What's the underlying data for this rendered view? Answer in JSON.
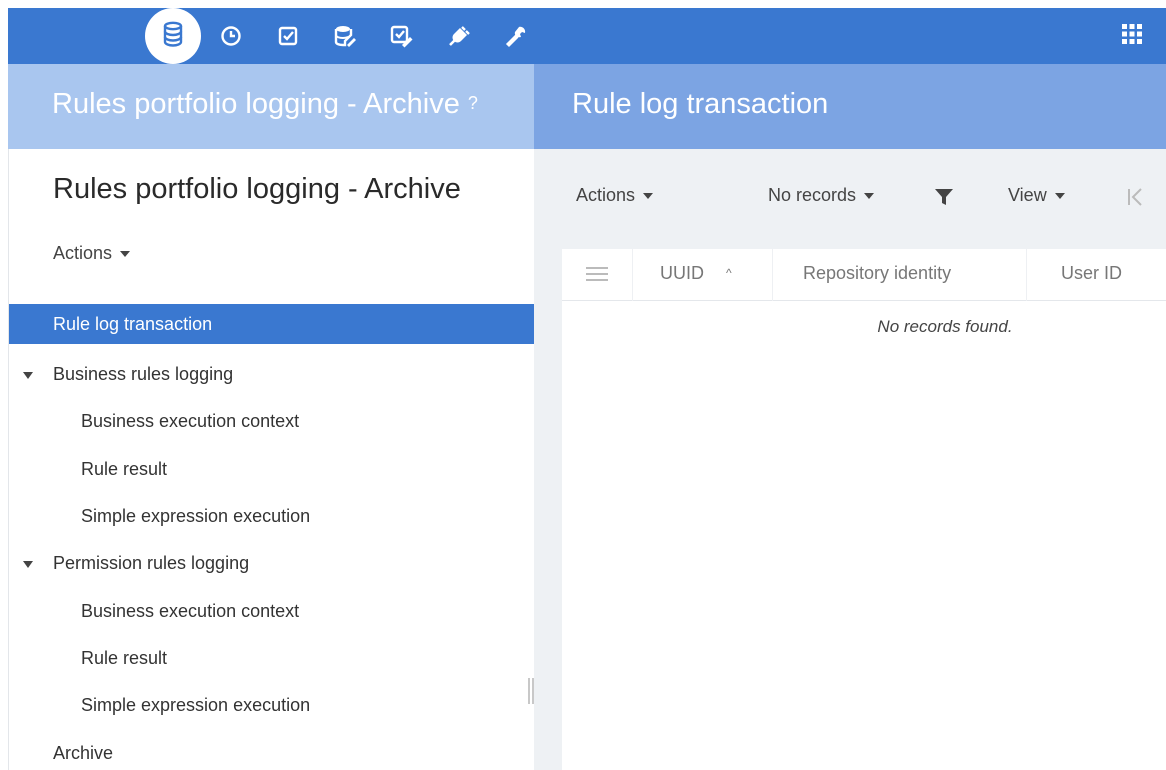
{
  "toolbar": {
    "icons": [
      "database-icon",
      "clock-icon",
      "checkbox-icon",
      "database-edit-icon",
      "checklist-edit-icon",
      "plug-icon",
      "wrench-icon"
    ],
    "active_icon": "database-icon",
    "apps_icon": "apps-grid-icon",
    "accent_color": "#3a78d0"
  },
  "header": {
    "left_title": "Rules portfolio logging - Archive",
    "help_mark": "?",
    "right_title": "Rule log transaction"
  },
  "left": {
    "page_title": "Rules portfolio logging - Archive",
    "actions_label": "Actions",
    "tree": [
      {
        "label": "Rule log transaction",
        "level": 0,
        "selected": true
      },
      {
        "label": "Business rules logging",
        "level": 0,
        "expanded": true
      },
      {
        "label": "Business execution context",
        "level": 1
      },
      {
        "label": "Rule result",
        "level": 1
      },
      {
        "label": "Simple expression execution",
        "level": 1
      },
      {
        "label": "Permission rules logging",
        "level": 0,
        "expanded": true
      },
      {
        "label": "Business execution context",
        "level": 1
      },
      {
        "label": "Rule result",
        "level": 1
      },
      {
        "label": "Simple expression execution",
        "level": 1
      },
      {
        "label": "Archive",
        "level": 0
      }
    ]
  },
  "right": {
    "actions_label": "Actions",
    "records_label": "No records",
    "view_label": "View",
    "columns": [
      "UUID",
      "Repository identity",
      "User ID"
    ],
    "empty_message": "No records found."
  }
}
